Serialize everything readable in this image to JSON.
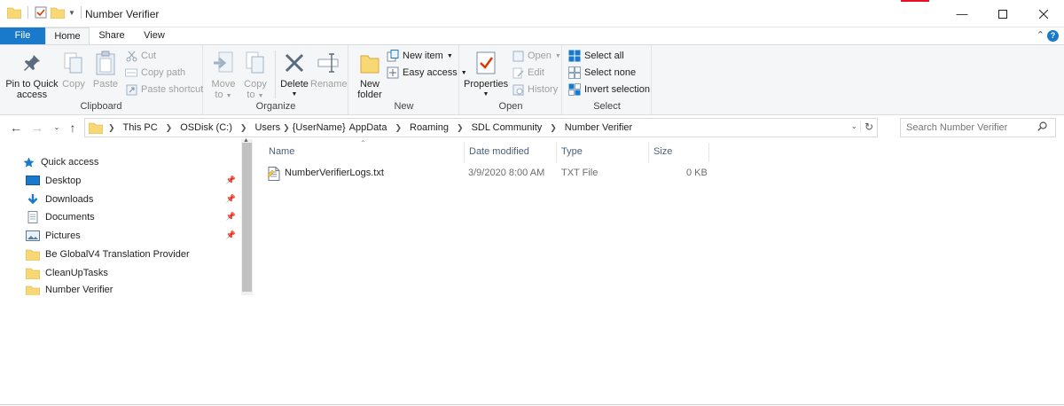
{
  "window": {
    "title": "Number Verifier"
  },
  "tabs": {
    "file": "File",
    "home": "Home",
    "share": "Share",
    "view": "View"
  },
  "ribbon": {
    "clipboard": {
      "label": "Clipboard",
      "pin_label": "Pin to Quick\naccess",
      "pin_line1": "Pin to Quick",
      "pin_line2": "access",
      "copy": "Copy",
      "paste": "Paste",
      "cut": "Cut",
      "copy_path": "Copy path",
      "paste_shortcut": "Paste shortcut"
    },
    "organize": {
      "label": "Organize",
      "move_line1": "Move",
      "move_line2": "to",
      "copy_line1": "Copy",
      "copy_line2": "to",
      "delete": "Delete",
      "rename": "Rename"
    },
    "new": {
      "label": "New",
      "new_folder_line1": "New",
      "new_folder_line2": "folder",
      "new_item": "New item",
      "easy_access": "Easy access"
    },
    "open": {
      "label": "Open",
      "properties": "Properties",
      "open": "Open",
      "edit": "Edit",
      "history": "History"
    },
    "select": {
      "label": "Select",
      "select_all": "Select all",
      "select_none": "Select none",
      "invert": "Invert selection"
    }
  },
  "address": {
    "crumbs": [
      "This PC",
      "OSDisk (C:)",
      "Users",
      "{UserName}",
      "AppData",
      "Roaming",
      "SDL Community",
      "Number Verifier"
    ]
  },
  "search": {
    "placeholder": "Search Number Verifier"
  },
  "nav": {
    "quick_access": "Quick access",
    "items": [
      {
        "label": "Desktop",
        "pinned": true
      },
      {
        "label": "Downloads",
        "pinned": true
      },
      {
        "label": "Documents",
        "pinned": true
      },
      {
        "label": "Pictures",
        "pinned": true
      },
      {
        "label": "Be GlobalV4 Translation Provider",
        "pinned": false
      },
      {
        "label": "CleanUpTasks",
        "pinned": false
      },
      {
        "label": "Number Verifier",
        "pinned": false
      }
    ]
  },
  "files": {
    "columns": {
      "name": "Name",
      "date": "Date modified",
      "type": "Type",
      "size": "Size"
    },
    "rows": [
      {
        "name": "NumberVerifierLogs.txt",
        "date": "3/9/2020 8:00 AM",
        "type": "TXT File",
        "size": "0 KB"
      }
    ]
  },
  "colors": {
    "accent": "#1979ca",
    "folder": "#f8d775",
    "ribbon_bg": "#f5f6f7"
  }
}
